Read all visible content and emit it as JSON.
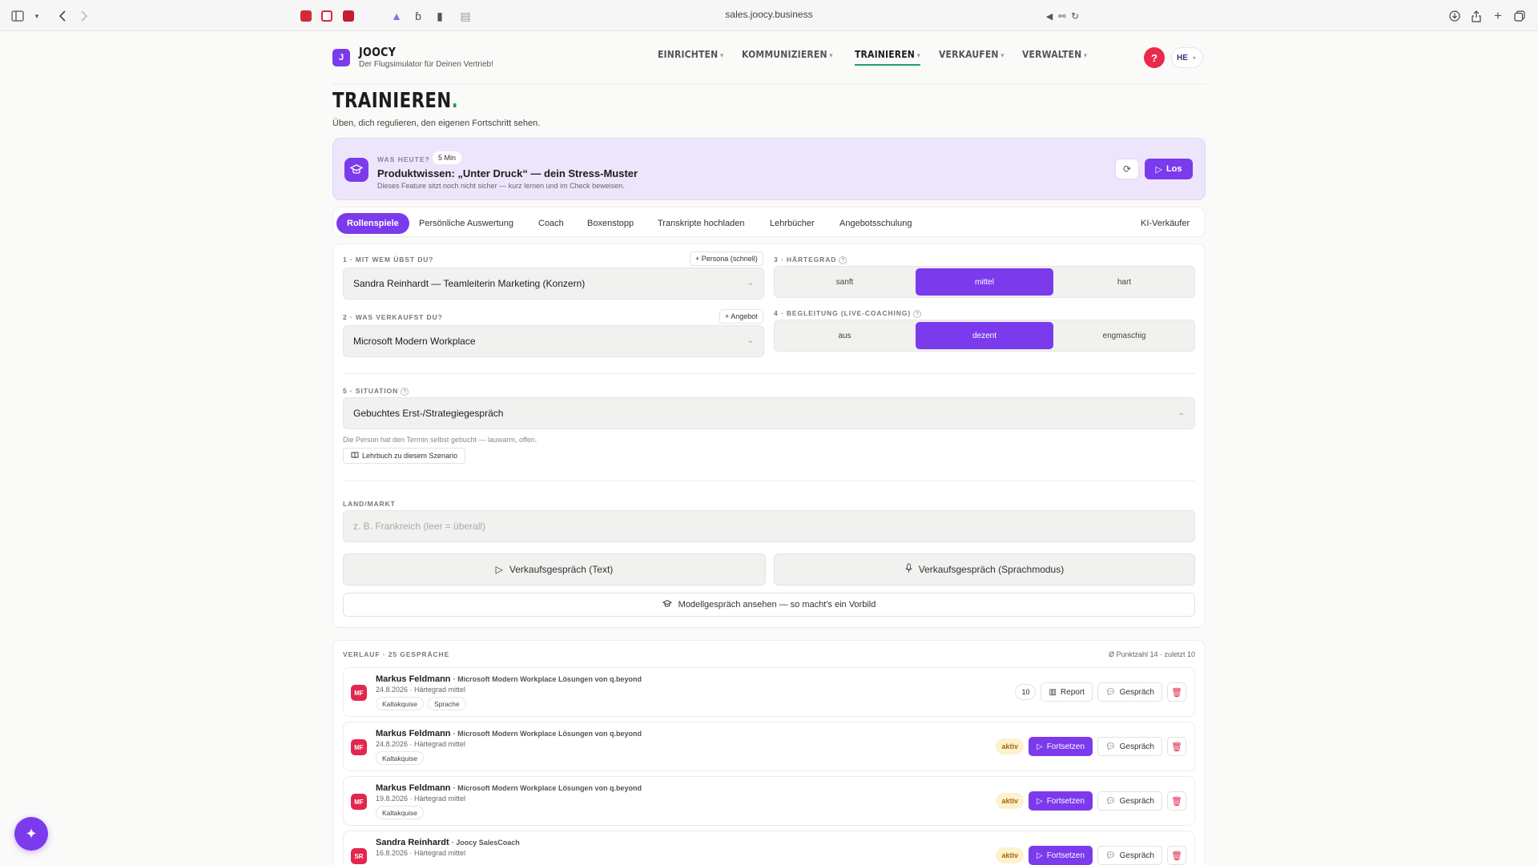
{
  "browser": {
    "url": "sales.joocy.business",
    "colors": {
      "ext1": "#d6283b",
      "ext2": "#d6283b",
      "ext3": "#c41e2f"
    }
  },
  "brand": {
    "logo_letter": "J",
    "name": "JOOCY",
    "tagline": "Der Flugsimulator für Deinen Vertrieb!",
    "accent": "#7c3aed",
    "green": "#1e9e6a"
  },
  "nav": {
    "items": [
      {
        "label": "EINRICHTEN",
        "active": false
      },
      {
        "label": "KOMMUNIZIEREN",
        "active": false
      },
      {
        "label": "TRAINIEREN",
        "active": true
      },
      {
        "label": "VERKAUFEN",
        "active": false
      },
      {
        "label": "VERWALTEN",
        "active": false
      }
    ],
    "help_label": "?",
    "user_initials": "HE"
  },
  "page": {
    "title": "TRAINIEREN",
    "title_dot": ".",
    "subtitle": "Üben, dich regulieren, den eigenen Fortschritt sehen."
  },
  "banner": {
    "kicker": "WAS HEUTE?",
    "duration": "5 Min",
    "title": "Produktwissen: „Unter Druck“ — dein Stress-Muster",
    "description": "Dieses Feature sitzt noch nicht sicher — kurz lernen und im Check beweisen.",
    "go_label": "Los"
  },
  "tabs": {
    "items": [
      "Rollenspiele",
      "Persönliche Auswertung",
      "Coach",
      "Boxenstopp",
      "Transkripte hochladen",
      "Lehrbücher",
      "Angebotsschulung"
    ],
    "right_label": "KI-Verkäufer"
  },
  "form": {
    "persona_label": "1 · MIT WEM ÜBST DU?",
    "persona_quick": "+ Persona (schnell)",
    "persona_value": "Sandra Reinhardt — Teamleiterin Marketing (Konzern)",
    "product_label": "2 · WAS VERKAUFST DU?",
    "product_add": "+ Angebot",
    "product_value": "Microsoft Modern Workplace",
    "difficulty_label": "3 · HÄRTEGRAD",
    "difficulty_options": [
      "sanft",
      "mittel",
      "hart"
    ],
    "coaching_label": "4 · BEGLEITUNG (LIVE-COACHING)",
    "coaching_options": [
      "aus",
      "dezent",
      "engmaschig"
    ],
    "situation_label": "5 · SITUATION",
    "situation_value": "Gebuchtes Erst-/Strategiegespräch",
    "situation_hint": "Die Person hat den Termin selbst gebucht — lauwarm, offen.",
    "textbook_btn": "Lehrbuch zu diesem Szenario",
    "market_label": "LAND/MARKT",
    "market_placeholder": "z. B. Frankreich (leer = überall)",
    "text_call_btn": "Verkaufsgespräch (Text)",
    "voice_call_btn": "Verkaufsgespräch (Sprachmodus)",
    "model_call_btn": "Modellgespräch ansehen — so macht's ein Vorbild"
  },
  "history": {
    "heading": "VERLAUF · 25 GESPRÄCHE",
    "stats": "Ø Punktzahl 14 · zuletzt 10",
    "report_label": "Report",
    "conversation_label": "Gespräch",
    "continue_label": "Fortsetzen",
    "active_label": "aktiv",
    "rows": [
      {
        "initials": "MF",
        "name": "Markus Feldmann",
        "product": "· Microsoft Modern Workplace Lösungen von q.beyond",
        "meta": "24.8.2026 · Härtegrad mittel",
        "tags": [
          "Kaltakquise",
          "Sprache"
        ],
        "score": "10",
        "status": "done"
      },
      {
        "initials": "MF",
        "name": "Markus Feldmann",
        "product": "· Microsoft Modern Workplace Lösungen von q.beyond",
        "meta": "24.8.2026 · Härtegrad mittel",
        "tags": [
          "Kaltakquise"
        ],
        "score": "",
        "status": "active"
      },
      {
        "initials": "MF",
        "name": "Markus Feldmann",
        "product": "· Microsoft Modern Workplace Lösungen von q.beyond",
        "meta": "19.8.2026 · Härtegrad mittel",
        "tags": [
          "Kaltakquise"
        ],
        "score": "",
        "status": "active"
      },
      {
        "initials": "SR",
        "name": "Sandra Reinhardt",
        "product": "· Joocy SalesCoach",
        "meta": "16.8.2026 · Härtegrad mittel",
        "tags": [],
        "score": "",
        "status": "active"
      }
    ]
  }
}
